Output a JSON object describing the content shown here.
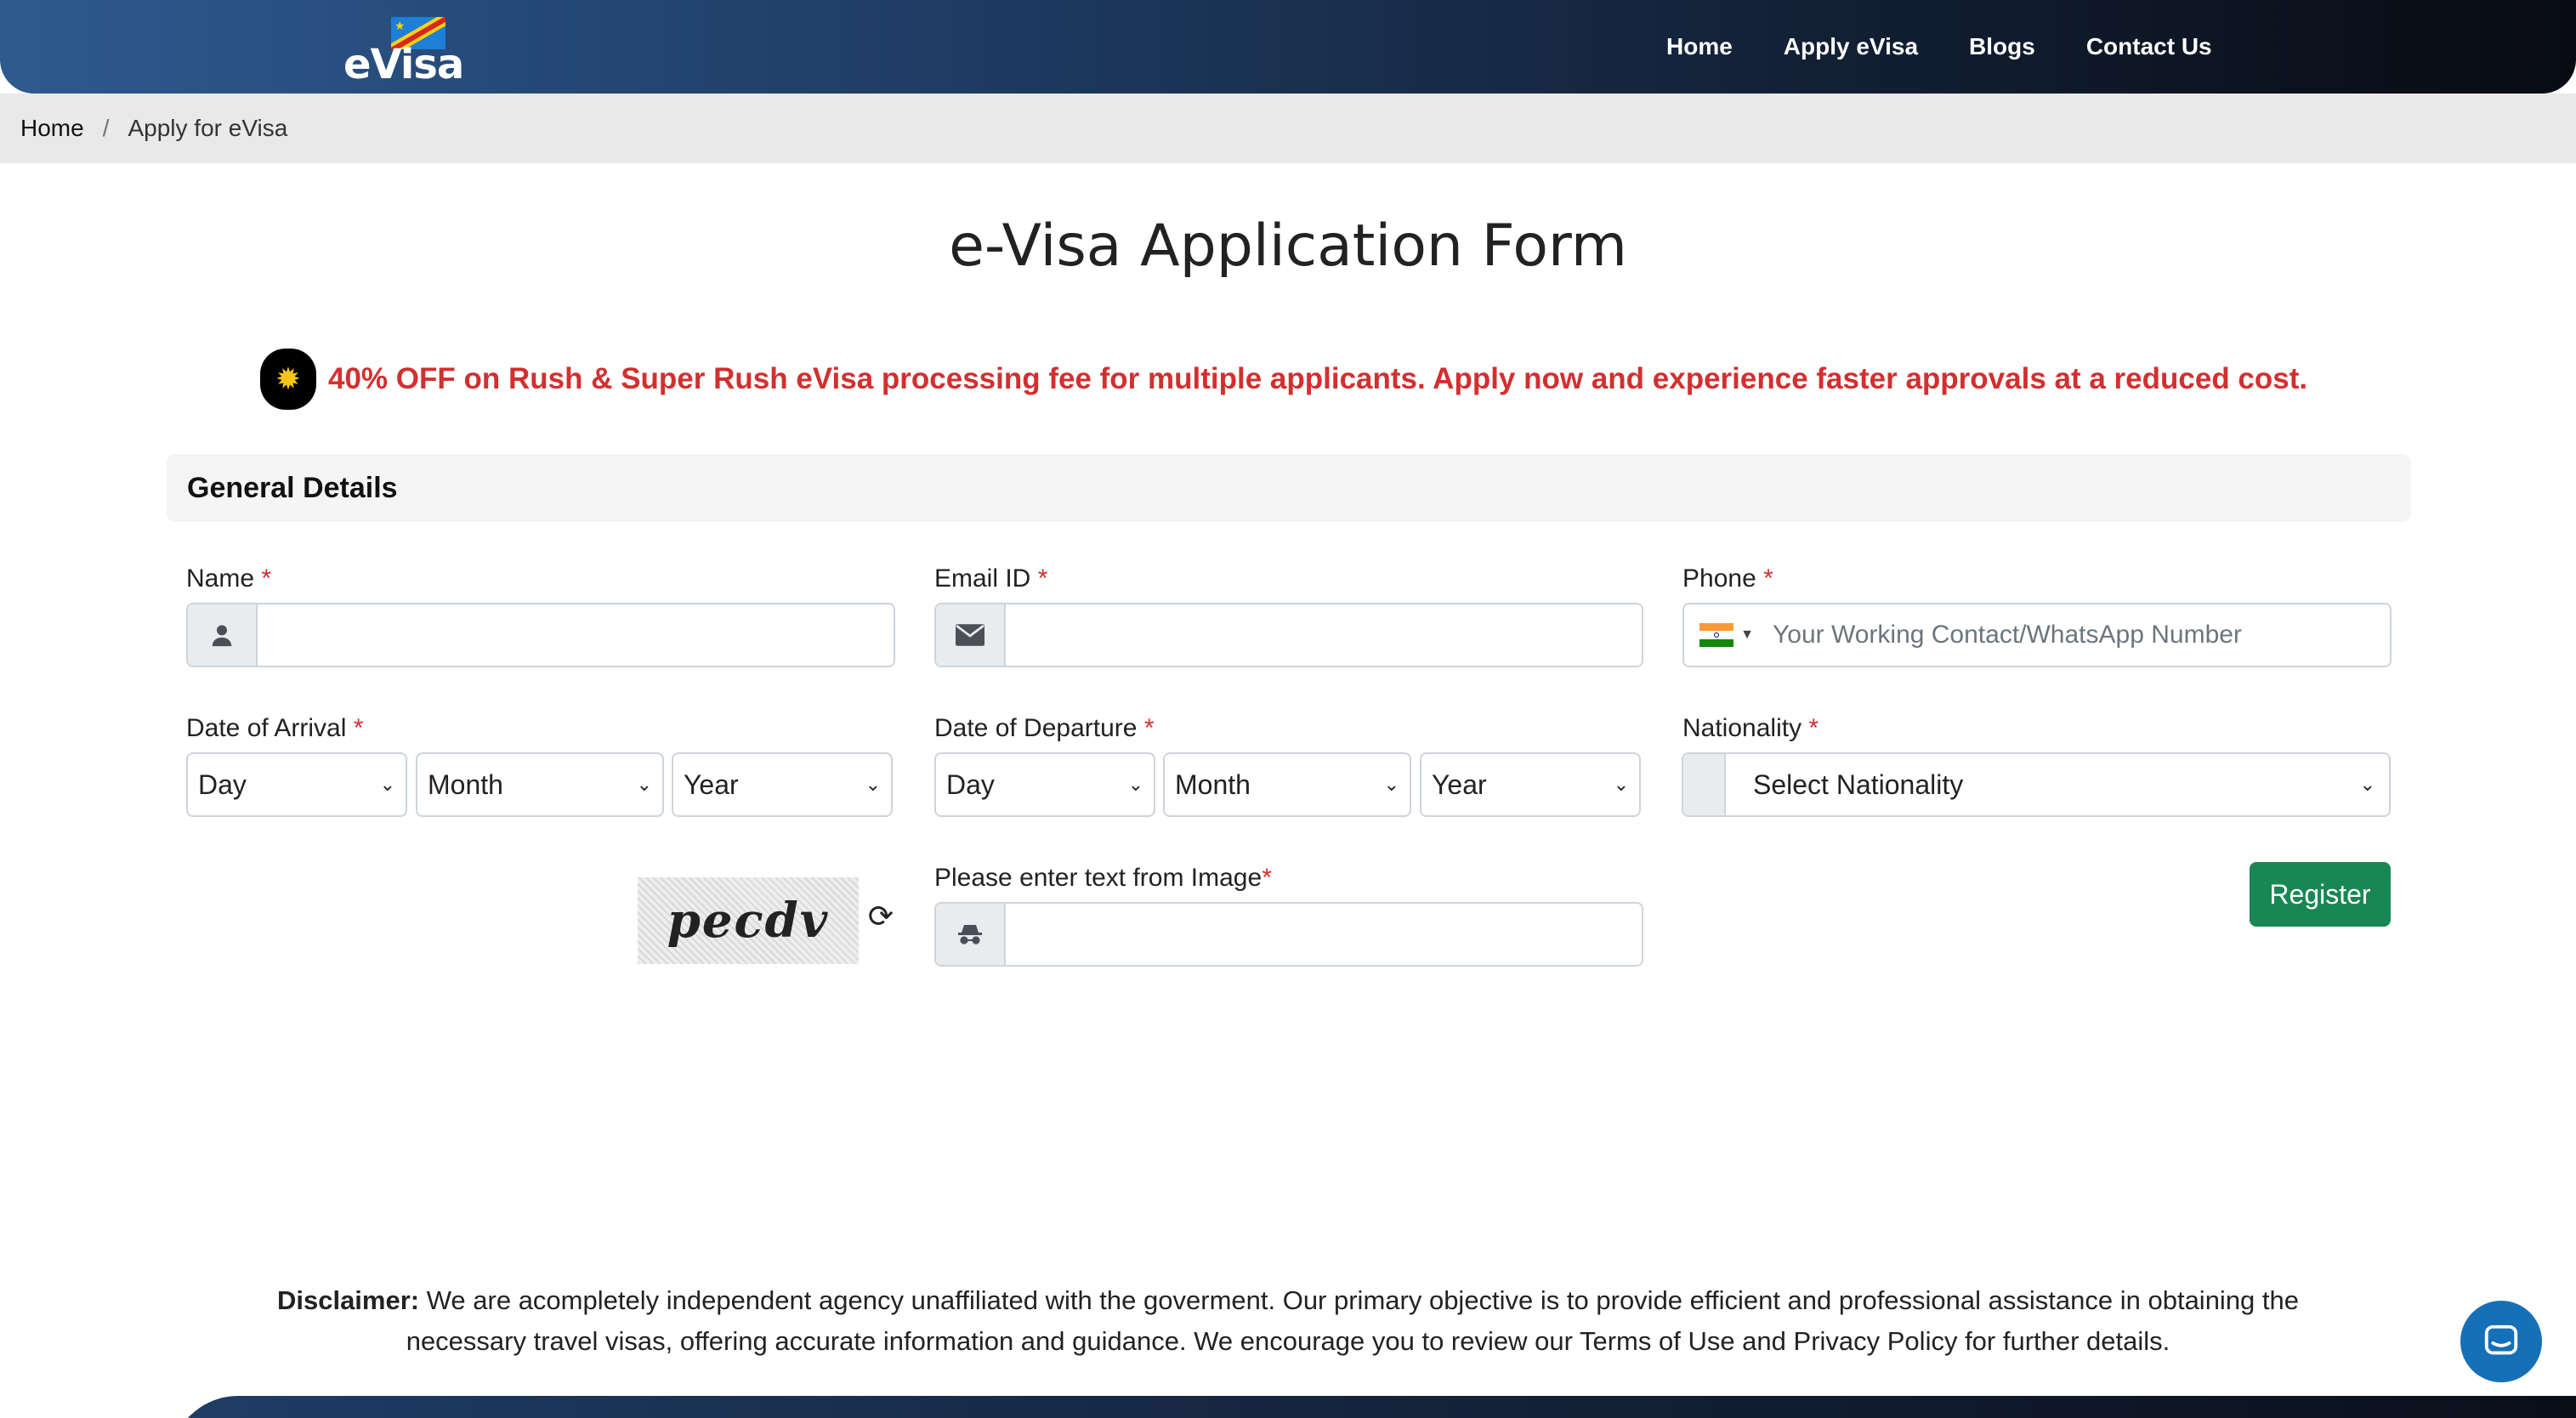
{
  "header": {
    "logo_text": "eVisa",
    "nav": [
      "Home",
      "Apply eVisa",
      "Blogs",
      "Contact Us"
    ]
  },
  "breadcrumb": {
    "home": "Home",
    "separator": "/",
    "current": "Apply for eVisa"
  },
  "page_title": "e-Visa Application Form",
  "offer": {
    "icon": "sun-icon",
    "text": "40% OFF on Rush & Super Rush eVisa processing fee for multiple applicants. Apply now and experience faster approvals at a reduced cost.",
    "color": "#d32f2f"
  },
  "section_title": "General Details",
  "form": {
    "name": {
      "label": "Name",
      "required": "*",
      "value": ""
    },
    "email": {
      "label": "Email ID",
      "required": "*",
      "value": ""
    },
    "phone": {
      "label": "Phone",
      "required": "*",
      "placeholder": "Your Working Contact/WhatsApp Number",
      "country": "India"
    },
    "arrival": {
      "label": "Date of Arrival",
      "required": "*",
      "day": "Day",
      "month": "Month",
      "year": "Year"
    },
    "departure": {
      "label": "Date of Departure",
      "required": "*",
      "day": "Day",
      "month": "Month",
      "year": "Year"
    },
    "nationality": {
      "label": "Nationality",
      "required": "*",
      "selected": "Select Nationality"
    },
    "captcha": {
      "image_text": "pecdv",
      "label": "Please enter text from Image",
      "required": "*",
      "value": ""
    },
    "register_label": "Register",
    "register_color": "#198754"
  },
  "disclaimer": {
    "bold": "Disclaimer:",
    "text": " We are acompletely independent agency unaffiliated with the goverment. Our primary objective is to provide efficient and professional assistance in obtaining the necessary travel visas, offering accurate information and guidance. We encourage you to review our Terms of Use and Privacy Policy for further details."
  },
  "chat_widget": {
    "icon": "chat-icon",
    "color": "#1670b8"
  }
}
